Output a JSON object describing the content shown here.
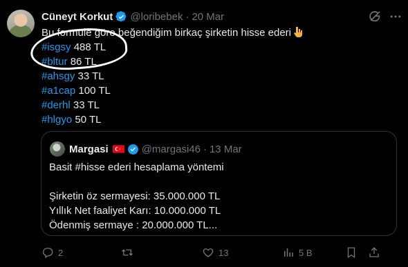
{
  "author": {
    "name": "Cüneyt Korkut",
    "handle": "@loribebek",
    "separator": "·",
    "date": "20 Mar"
  },
  "tweet": {
    "intro": "Bu formüle göre beğendiğim birkaç şirketin hisse ederi",
    "stocks": [
      {
        "tag": "#isgsy",
        "value": "488 TL"
      },
      {
        "tag": "#bltur",
        "value": "86 TL"
      },
      {
        "tag": "#ahsgy",
        "value": "33 TL"
      },
      {
        "tag": "#a1cap",
        "value": "100 TL"
      },
      {
        "tag": "#derhl",
        "value": "33 TL"
      },
      {
        "tag": "#hlgyo",
        "value": "50 TL"
      }
    ]
  },
  "quote": {
    "name": "Margasi",
    "handle": "@margasi46",
    "separator": "·",
    "date": "13 Mar",
    "lines": [
      "Basit #hisse ederi hesaplama yöntemi",
      "",
      "Şirketin öz sermayesi: 35.000.000 TL",
      "Yıllık Net faaliyet Karı: 10.000.000 TL",
      "Ödenmiş sermaye : 20.000.000 TL..."
    ]
  },
  "actions": {
    "replies": "2",
    "retweets": "",
    "likes": "13",
    "views": "5 B"
  },
  "icons": [
    "grok-icon",
    "more-icon",
    "verified-icon",
    "flag-icon",
    "reply-icon",
    "retweet-icon",
    "like-icon",
    "views-icon",
    "bookmark-icon",
    "share-icon"
  ],
  "colors": {
    "accent": "#1d9bf0",
    "muted": "#71767b",
    "text": "#e7e9ea",
    "border": "#2f3336"
  }
}
